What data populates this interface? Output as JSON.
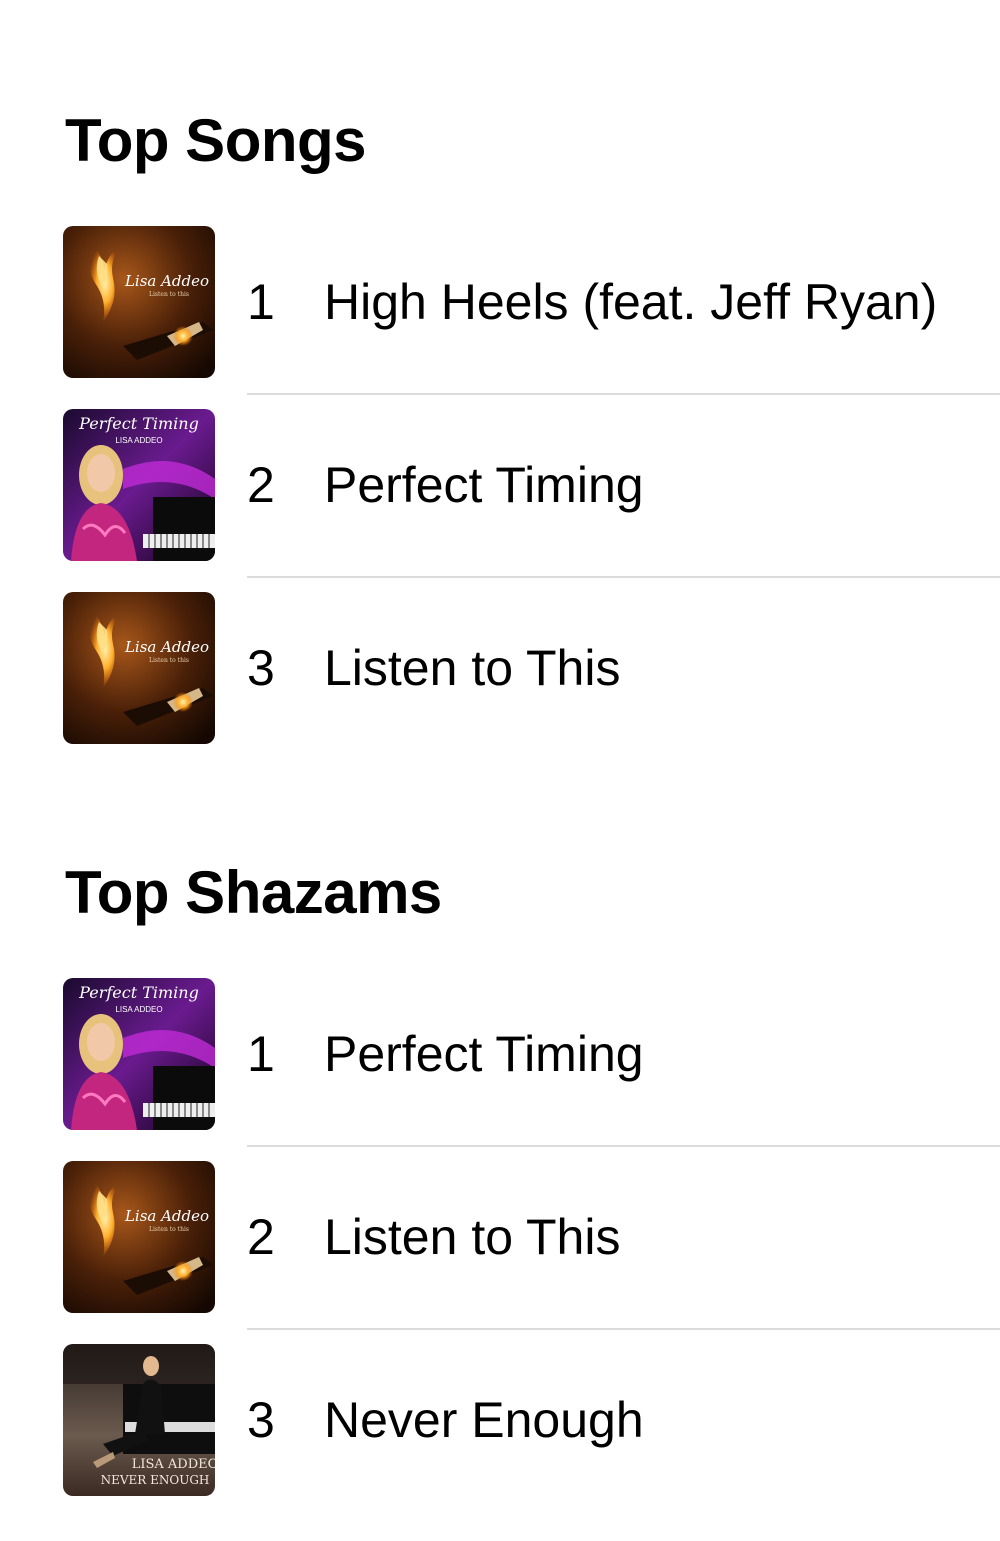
{
  "top_songs": {
    "title": "Top Songs",
    "items": [
      {
        "rank": "1",
        "title": "High Heels (feat. Jeff Ryan)",
        "artwork": "listen-to-this",
        "art_line1": "Lisa Addeo",
        "art_line2": "Listen to this"
      },
      {
        "rank": "2",
        "title": "Perfect Timing",
        "artwork": "perfect-timing",
        "art_line1": "Perfect Timing",
        "art_line2": "LISA ADDEO"
      },
      {
        "rank": "3",
        "title": "Listen to This",
        "artwork": "listen-to-this",
        "art_line1": "Lisa Addeo",
        "art_line2": "Listen to this"
      }
    ]
  },
  "top_shazams": {
    "title": "Top Shazams",
    "items": [
      {
        "rank": "1",
        "title": "Perfect Timing",
        "artwork": "perfect-timing",
        "art_line1": "Perfect Timing",
        "art_line2": "LISA ADDEO"
      },
      {
        "rank": "2",
        "title": "Listen to This",
        "artwork": "listen-to-this",
        "art_line1": "Lisa Addeo",
        "art_line2": "Listen to this"
      },
      {
        "rank": "3",
        "title": "Never Enough",
        "artwork": "never-enough",
        "art_line1": "LISA ADDEO",
        "art_line2": "NEVER ENOUGH"
      }
    ]
  }
}
